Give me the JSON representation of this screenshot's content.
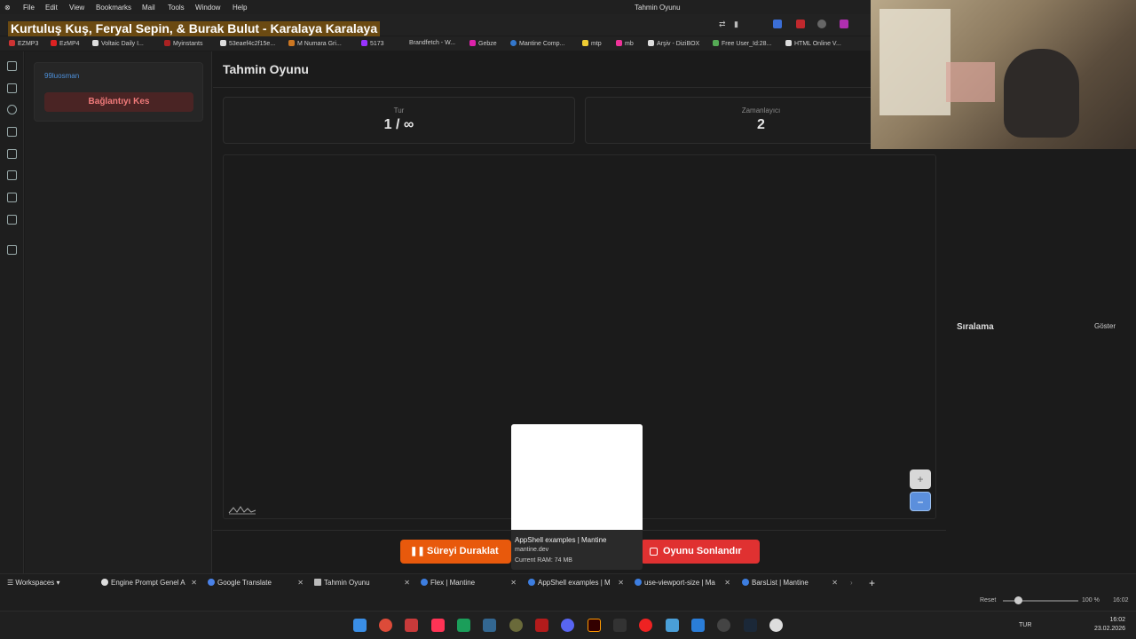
{
  "browser": {
    "window_title": "Tahmin Oyunu",
    "menu": [
      "File",
      "Edit",
      "View",
      "Bookmarks",
      "Mail",
      "Tools",
      "Window",
      "Help"
    ],
    "now_playing": "Kurtuluş Kuş, Feryal Sepin, & Burak Bulut - Karalaya Karalaya",
    "bookmarks": [
      "EZMP3",
      "EzMP4",
      "Voltaic Daily I...",
      "Myinstants",
      "53eaef4c2f15e...",
      "M Numara Gri...",
      "5173",
      "Brandfetch - W...",
      "Gebze",
      "Mantine Comp...",
      "mtp",
      "mb",
      "Arşiv - DiziBOX",
      "Free User_Id:28...",
      "HTML Online V..."
    ]
  },
  "app": {
    "user": {
      "name": "99luosman",
      "disconnect_label": "Bağlantıyı Kes"
    },
    "title": "Tahmin Oyunu",
    "stats": {
      "round_label": "Tur",
      "round_value": "1 / ∞",
      "timer_label": "Zamanlayıcı",
      "timer_value": "2"
    },
    "ranking": {
      "title": "Sıralama",
      "toggle": "Göster"
    },
    "actions": {
      "pause": "Süreyi Duraklat",
      "end": "Oyunu Sonlandır"
    },
    "zoom": {
      "in": "+",
      "out": "−"
    }
  },
  "tooltip": {
    "title": "AppShell examples | Mantine",
    "url": "mantine.dev",
    "ram": "Current RAM: 74 MB"
  },
  "tabs": {
    "workspaces": "Workspaces",
    "items": [
      "Engine Prompt Genel A",
      "Google Translate",
      "Tahmin Oyunu",
      "Flex | Mantine",
      "AppShell examples | M",
      "use-viewport-size | Ma",
      "BarsList | Mantine"
    ]
  },
  "status": {
    "reset": "Reset",
    "zoom": "100 %",
    "time": "16:02"
  },
  "taskbar": {
    "lang": "TUR",
    "time": "16:02",
    "date": "23.02.2026"
  },
  "colors": {
    "accent_orange": "#e8590c",
    "accent_red": "#e03131",
    "link_blue": "#4d8fd9"
  }
}
